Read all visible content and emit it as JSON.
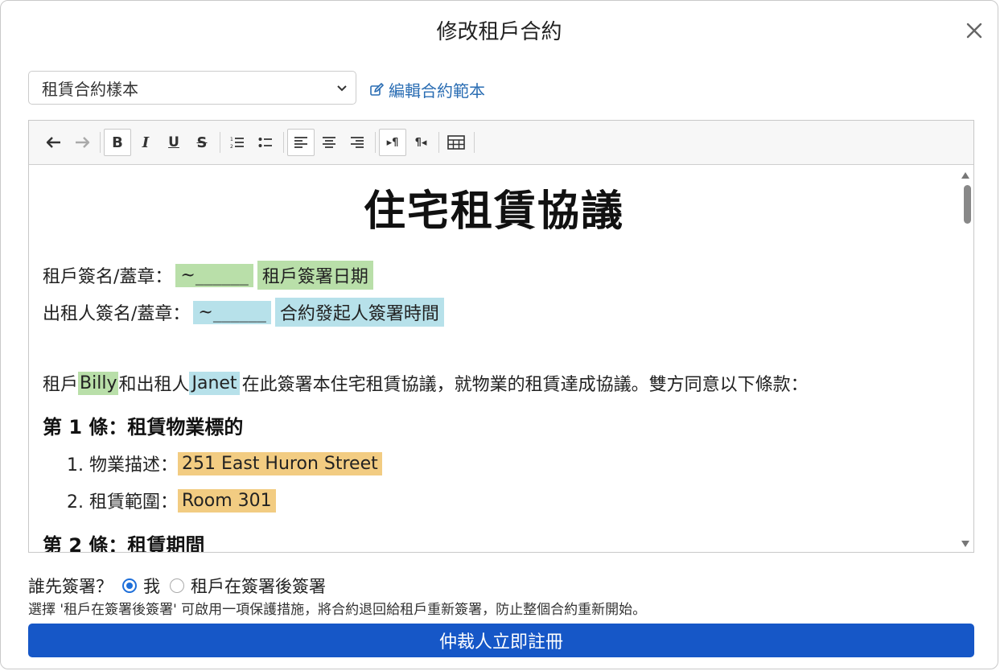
{
  "dialog": {
    "title": "修改租戶合約",
    "close_icon": "close-icon"
  },
  "template_select": {
    "value": "租賃合約樣本"
  },
  "edit_template_link": "編輯合約範本",
  "toolbar": {
    "icons": [
      "undo-icon",
      "redo-icon",
      "bold-icon",
      "italic-icon",
      "underline-icon",
      "strikethrough-icon",
      "ordered-list-icon",
      "bullet-list-icon",
      "align-left-icon",
      "align-center-icon",
      "align-right-icon",
      "ltr-icon",
      "rtl-icon",
      "table-icon"
    ],
    "bold_label": "B",
    "italic_label": "I",
    "underline_label": "U",
    "strike_label": "S",
    "ltr_label": "▸¶",
    "rtl_label": "¶◂"
  },
  "document": {
    "title": "住宅租賃協議",
    "tenant_sign_label": "租戶簽名/蓋章：",
    "tenant_sign_field": "~______",
    "tenant_sign_date": "租戶簽署日期",
    "landlord_sign_label": "出租人簽名/蓋章：",
    "landlord_sign_field": "~______",
    "landlord_sign_time": "合約發起人簽署時間",
    "intro_prefix": "租戶",
    "tenant_name": "Billy",
    "intro_middle": "和出租人",
    "landlord_name": "Janet",
    "intro_suffix": "在此簽署本住宅租賃協議，就物業的租賃達成協議。雙方同意以下條款：",
    "section1_title": "第 1 條：租賃物業標的",
    "item1_label": "1. 物業描述：",
    "item1_value": "251 East Huron Street",
    "item2_label": "2. 租賃範圍：",
    "item2_value": "Room 301",
    "section2_title": "第 2 條：租賃期間"
  },
  "signing_order": {
    "question": "誰先簽署？",
    "option_me": "我",
    "option_tenant_after": "租戶在簽署後簽署",
    "selected": "我"
  },
  "note": "選擇 '租戶在簽署後簽署' 可啟用一項保護措施，將合約退回給租戶重新簽署，防止整個合約重新開始。",
  "submit_button": "仲裁人立即註冊",
  "colors": {
    "tenant_highlight": "#b9dfa9",
    "landlord_highlight": "#b7e1ea",
    "field_highlight": "#f2cc82",
    "primary": "#1657c7",
    "link": "#2a6db3"
  }
}
